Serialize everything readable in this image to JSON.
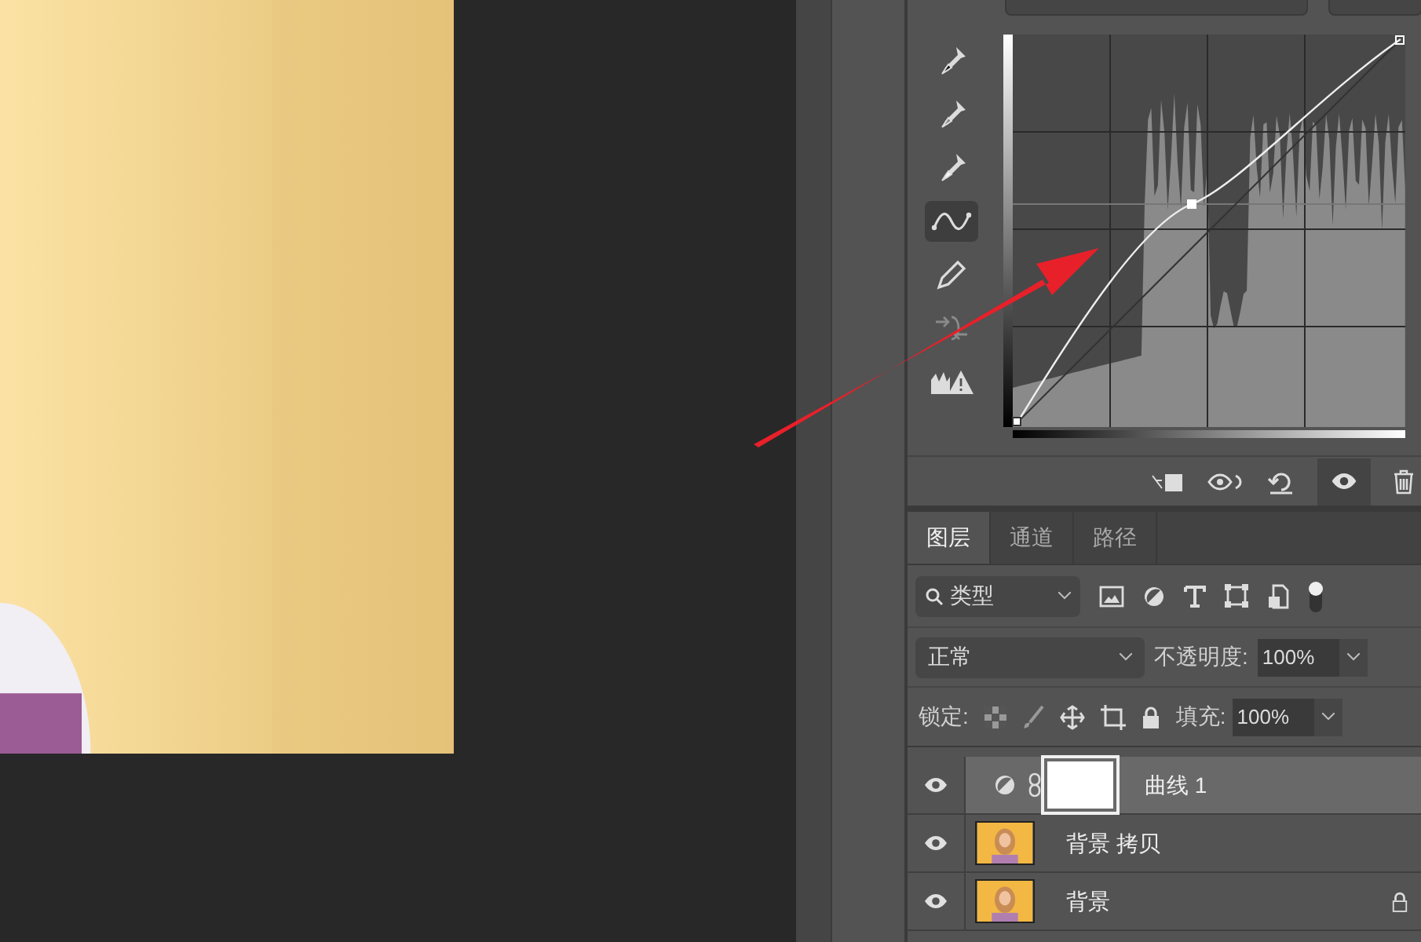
{
  "curves_tools": [
    {
      "kind": "eyedropper-black",
      "selected": false
    },
    {
      "kind": "eyedropper-gray",
      "selected": false
    },
    {
      "kind": "eyedropper-white",
      "selected": false
    },
    {
      "kind": "curve",
      "selected": true
    },
    {
      "kind": "pencil",
      "selected": false
    },
    {
      "kind": "smooth",
      "selected": false
    },
    {
      "kind": "clipping",
      "selected": false
    }
  ],
  "layers_panel": {
    "tabs": [
      {
        "label": "图层",
        "selected": true
      },
      {
        "label": "通道",
        "selected": false
      },
      {
        "label": "路径",
        "selected": false
      }
    ],
    "filter": {
      "value": "类型"
    },
    "blend_mode": {
      "value": "正常"
    },
    "opacity": {
      "label": "不透明度:",
      "value": "100%"
    },
    "lock": {
      "label": "锁定:"
    },
    "fill": {
      "label": "填充:",
      "value": "100%"
    },
    "layers": [
      {
        "kind": "adjustment",
        "name": "曲线 1",
        "visible": true,
        "selected": true,
        "locked": false
      },
      {
        "kind": "pixel",
        "name": "背景 拷贝",
        "visible": true,
        "selected": false,
        "locked": false
      },
      {
        "kind": "pixel",
        "name": "背景",
        "visible": true,
        "selected": false,
        "locked": true
      }
    ]
  }
}
